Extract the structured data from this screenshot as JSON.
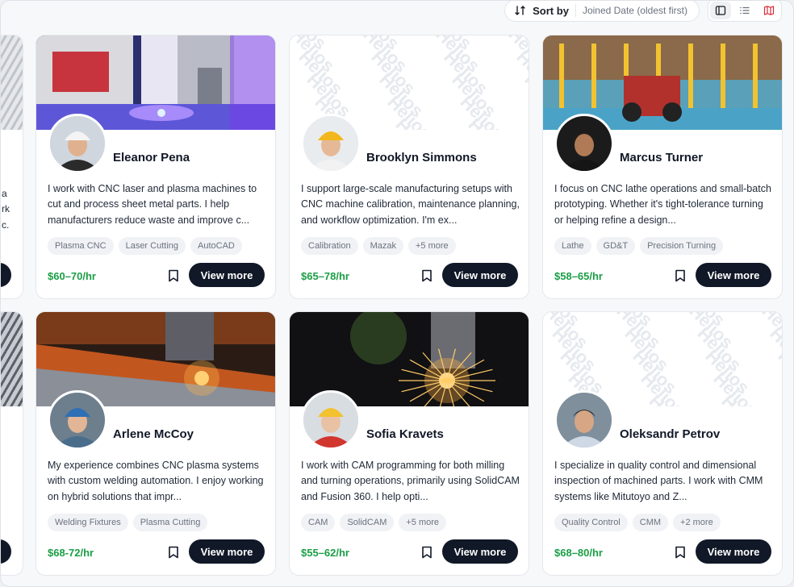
{
  "toolbar": {
    "sort_label": "Sort by",
    "sort_value": "Joined Date (oldest first)",
    "views": [
      "card-view-icon",
      "list-view-icon",
      "map-view-icon"
    ]
  },
  "watermark_text": "Helios",
  "cards": [
    {
      "name": "Eleanor Pena",
      "bio": "I work with CNC laser and plasma machines to cut and process sheet metal parts. I help manufacturers reduce waste and improve c...",
      "tags": [
        "Plasma CNC",
        "Laser Cutting",
        "AutoCAD"
      ],
      "rate": "$60–70/hr",
      "cta": "View more"
    },
    {
      "name": "Brooklyn Simmons",
      "bio": "I support large-scale manufacturing setups with CNC machine calibration, maintenance planning, and workflow optimization. I'm ex...",
      "tags": [
        "Calibration",
        "Mazak",
        "+5 more"
      ],
      "rate": "$65–78/hr",
      "cta": "View more"
    },
    {
      "name": "Marcus Turner",
      "bio": "I focus on CNC lathe operations and small-batch prototyping. Whether it's tight-tolerance turning or helping refine a design...",
      "tags": [
        "Lathe",
        "GD&T",
        "Precision Turning"
      ],
      "rate": "$58–65/hr",
      "cta": "View more"
    },
    {
      "name": "Arlene McCoy",
      "bio": "My experience combines CNC plasma systems with custom welding automation. I enjoy working on hybrid solutions that impr...",
      "tags": [
        "Welding Fixtures",
        "Plasma Cutting"
      ],
      "rate": "$68-72/hr",
      "cta": "View more"
    },
    {
      "name": "Sofia Kravets",
      "bio": "I work with CAM programming for both milling and turning operations, primarily using SolidCAM and Fusion 360. I help opti...",
      "tags": [
        "CAM",
        "SolidCAM",
        "+5 more"
      ],
      "rate": "$55–62/hr",
      "cta": "View more"
    },
    {
      "name": "Oleksandr Petrov",
      "bio": "I specialize in quality control and dimensional inspection of machined parts. I work with CMM systems like Mitutoyo and Z...",
      "tags": [
        "Quality Control",
        "CMM",
        "+2 more"
      ],
      "rate": "$68–80/hr",
      "cta": "View more"
    }
  ],
  "partial_left": {
    "bio_fragments_row1": [
      "a",
      "rk",
      "c."
    ],
    "bio_fragments_row2": [
      "",
      "",
      "."
    ]
  },
  "colors": {
    "rate": "#1a9e45",
    "button": "#111827",
    "tag_bg": "#f0f2f5",
    "accent_icon": "#d62d3a"
  }
}
